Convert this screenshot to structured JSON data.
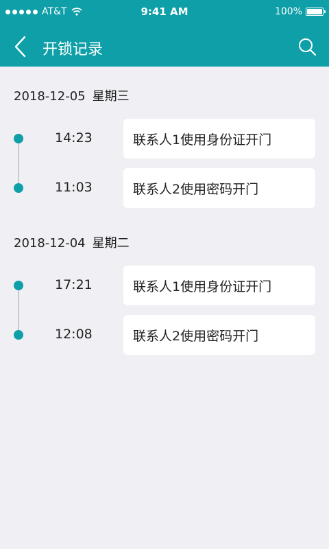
{
  "status_bar": {
    "carrier": "AT&T",
    "time": "9:41 AM",
    "battery": "100%"
  },
  "nav": {
    "title": "开锁记录",
    "back_icon": "chevron-left-icon",
    "search_icon": "search-icon"
  },
  "colors": {
    "accent": "#0e9fa8",
    "background": "#efeff4",
    "card": "#ffffff"
  },
  "groups": [
    {
      "date": "2018-12-05",
      "weekday": "星期三",
      "records": [
        {
          "time": "14:23",
          "text": "联系人1使用身份证开门"
        },
        {
          "time": "11:03",
          "text": "联系人2使用密码开门"
        }
      ]
    },
    {
      "date": "2018-12-04",
      "weekday": "星期二",
      "records": [
        {
          "time": "17:21",
          "text": "联系人1使用身份证开门"
        },
        {
          "time": "12:08",
          "text": "联系人2使用密码开门"
        }
      ]
    }
  ]
}
